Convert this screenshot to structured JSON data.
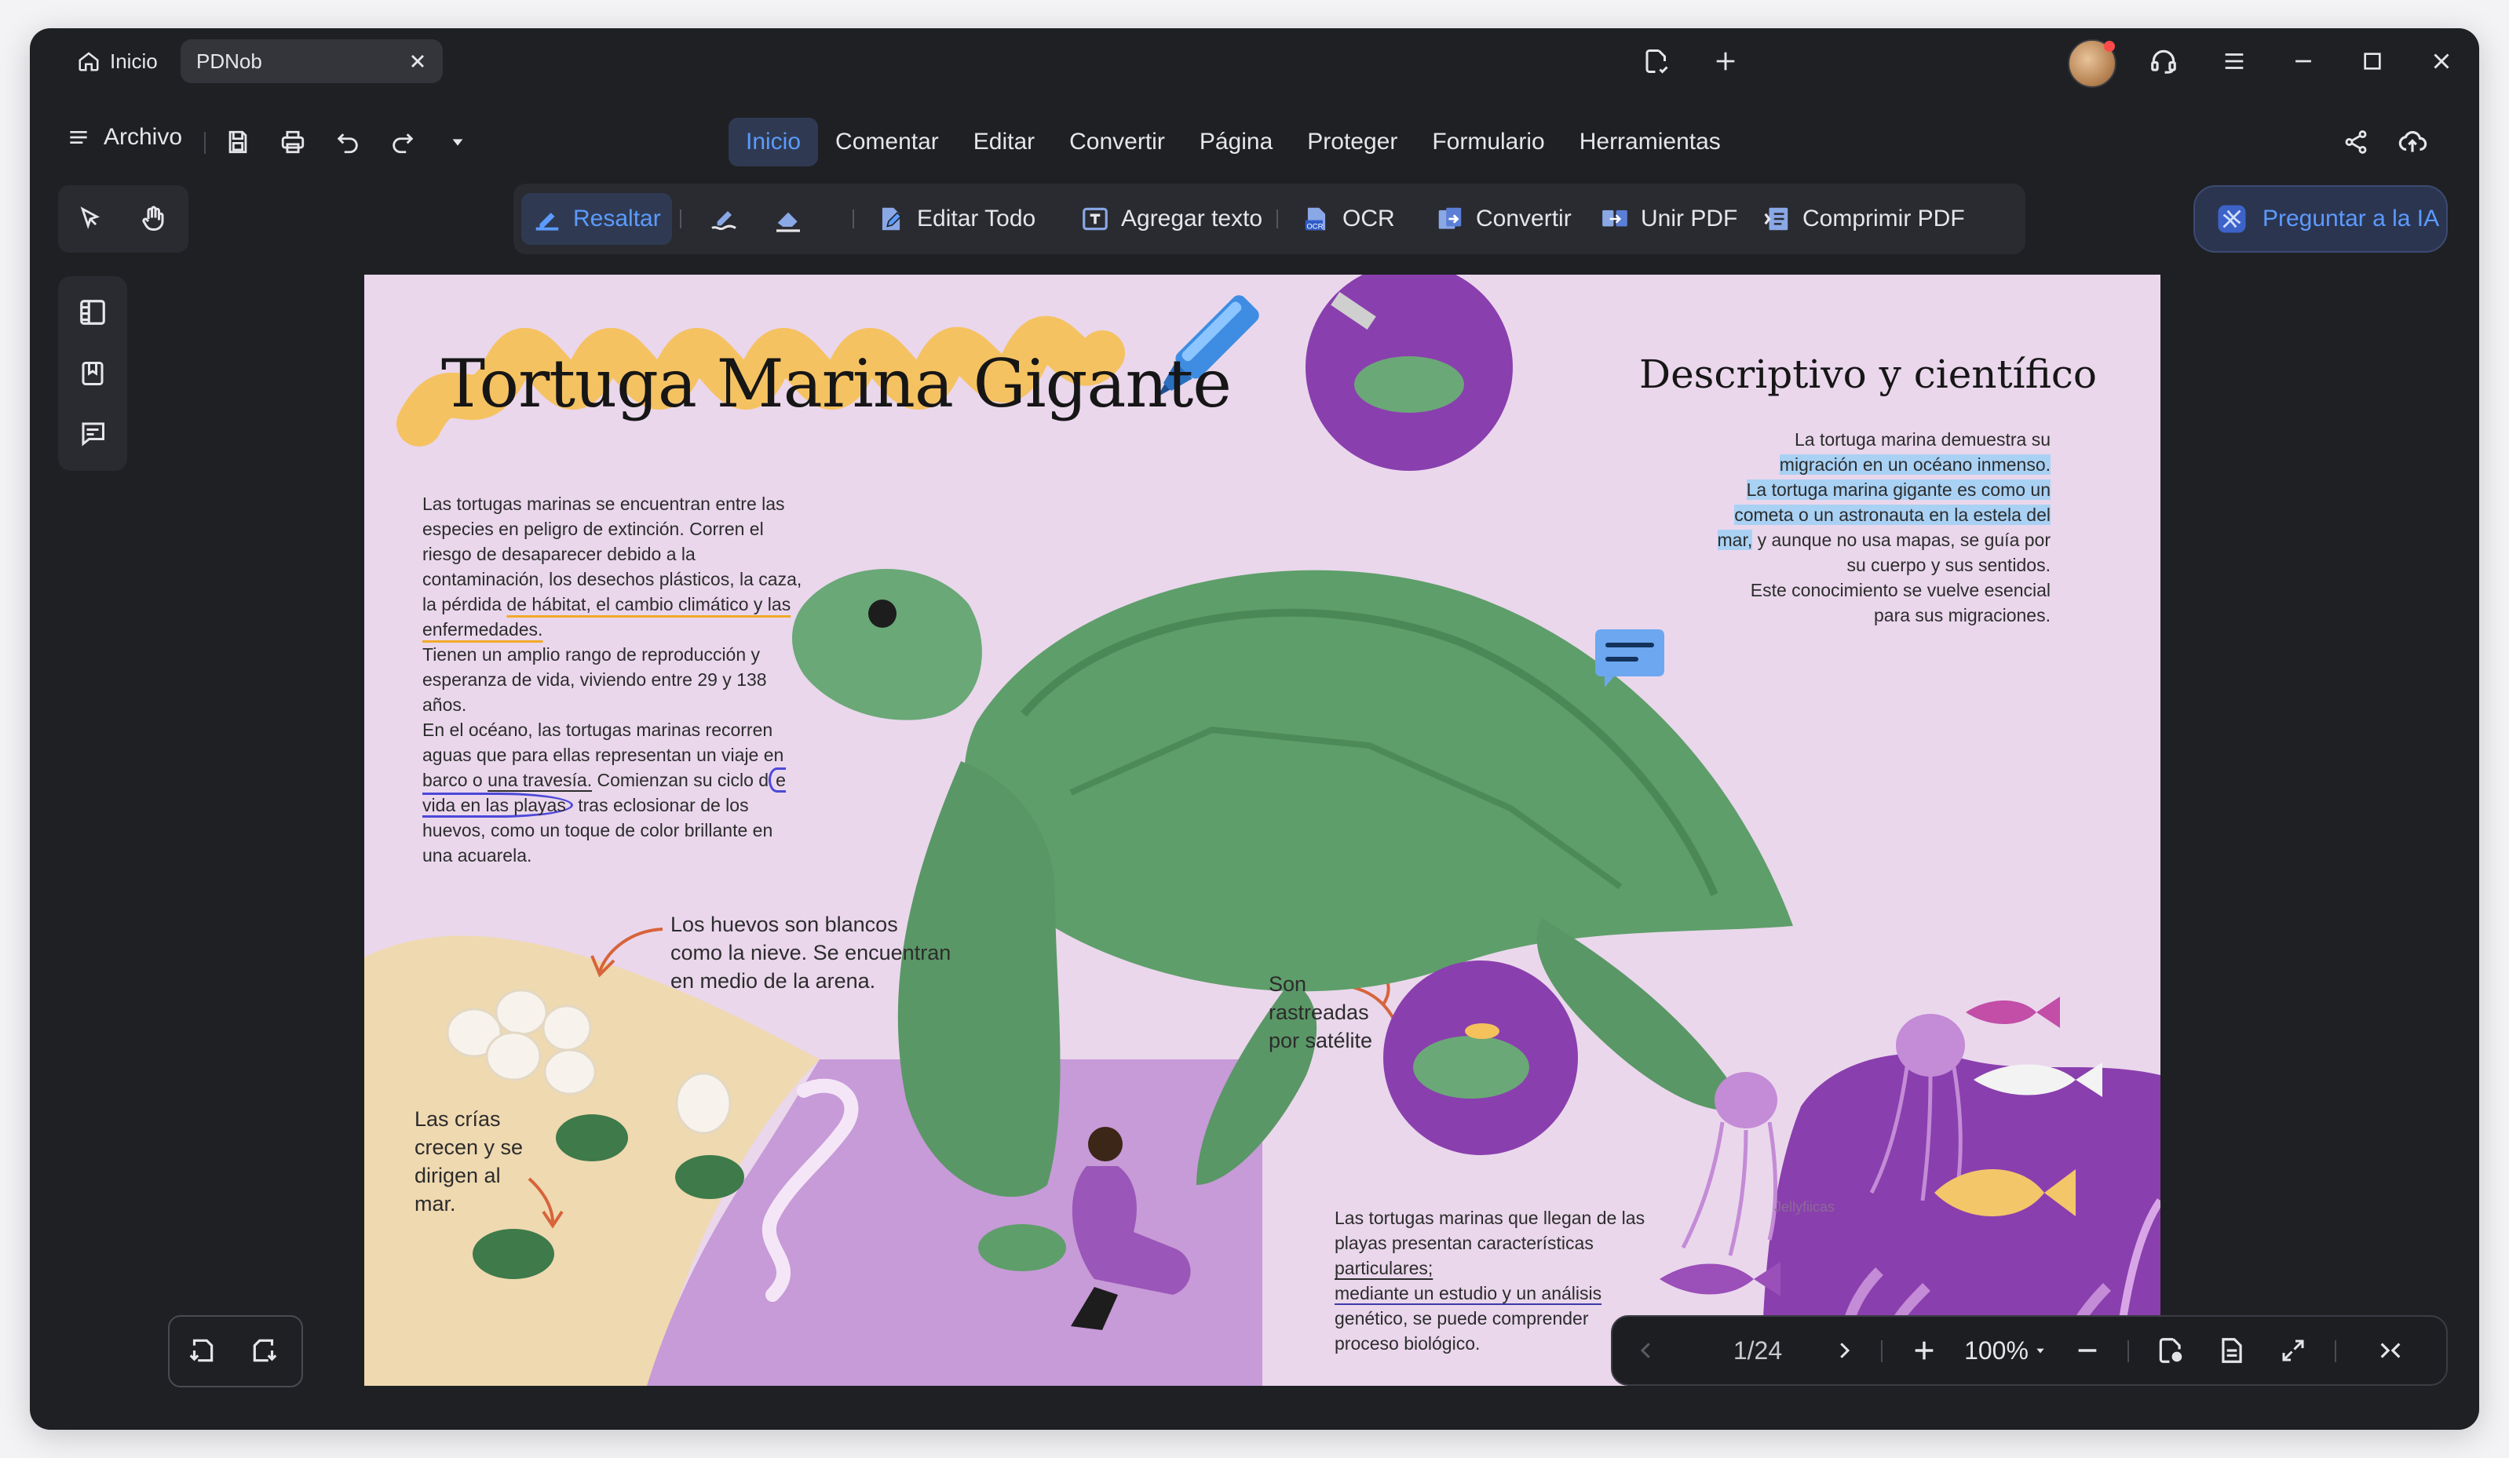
{
  "titlebar": {
    "home_tab": "Inicio",
    "doc_tab": "PDNob"
  },
  "menubar": {
    "archivo": "Archivo",
    "tabs": [
      {
        "label": "Inicio",
        "active": true
      },
      {
        "label": "Comentar"
      },
      {
        "label": "Editar"
      },
      {
        "label": "Convertir"
      },
      {
        "label": "Página"
      },
      {
        "label": "Proteger"
      },
      {
        "label": "Formulario"
      },
      {
        "label": "Herramientas"
      }
    ]
  },
  "toolbar": {
    "highlight": "Resaltar",
    "edit_all": "Editar Todo",
    "add_text": "Agregar texto",
    "ocr": "OCR",
    "convert": "Convertir",
    "merge": "Unir PDF",
    "compress": "Comprimir PDF",
    "ask_ai": "Preguntar a la IA"
  },
  "document": {
    "title": "Tortuga Marina Gigante",
    "body_p1_a": "Las tortugas marinas se encuentran entre las especies en peligro de extinción. Corren el riesgo de desaparecer debido a la contaminación, los desechos plásticos, la caza, la pérdida ",
    "body_p1_hl": "de hábitat, el cambio climático y las enfermedades.",
    "body_p2": "Tienen un amplio rango de reproducción y esperanza de vida, viviendo entre 29 y 138 años.",
    "body_p3_a": "En el océano, las tortugas marinas recorren aguas que para ellas representan un viaje en barco o ",
    "body_p3_u": "una travesía.",
    "body_p3_b": " Comienzan su ciclo d",
    "body_p3_c": "e vida en las playas",
    "body_p3_d": " tras eclosionar de los huevos, como un toque de color brillante en una acuarela.",
    "right_title": "Descriptivo y científico",
    "right_l1": "La tortuga marina demuestra su",
    "right_l2": "migración en un océano inmenso.",
    "right_l3": "La tortuga marina gigante es como un",
    "right_l4": "cometa o un astronauta en la estela del",
    "right_l5": "mar,",
    "right_l5b": " y aunque no usa mapas, se guía por",
    "right_l6": "su cuerpo y sus sentidos.",
    "right_l7": "Este conocimiento se vuelve esencial",
    "right_l8": "para sus migraciones.",
    "eggs_note": "Los huevos son blancos como la nieve. Se encuentran en medio de la arena.",
    "hatch_note": "Las crías crecen y se dirigen al mar.",
    "tracked_note": "Son rastreadas por satélite",
    "jelly_label": "Jellyfiicas",
    "bottom_a": "Las tortugas marinas que llegan de las playas presentan características ",
    "bottom_u1": "particulares;",
    "bottom_u2": "mediante un estudio y un análisis",
    "bottom_b": " genético, se puede comprender",
    "bottom_c": " proceso biológico."
  },
  "navigation": {
    "page": "1/24",
    "zoom": "100%"
  },
  "colors": {
    "accent": "#5b9bff",
    "page_bg": "#ead7ec",
    "turtle_green": "#5e9e6a",
    "purple": "#8a3fae",
    "highlight_yellow": "#f5c15b",
    "highlight_blue": "#a9d1f4"
  }
}
